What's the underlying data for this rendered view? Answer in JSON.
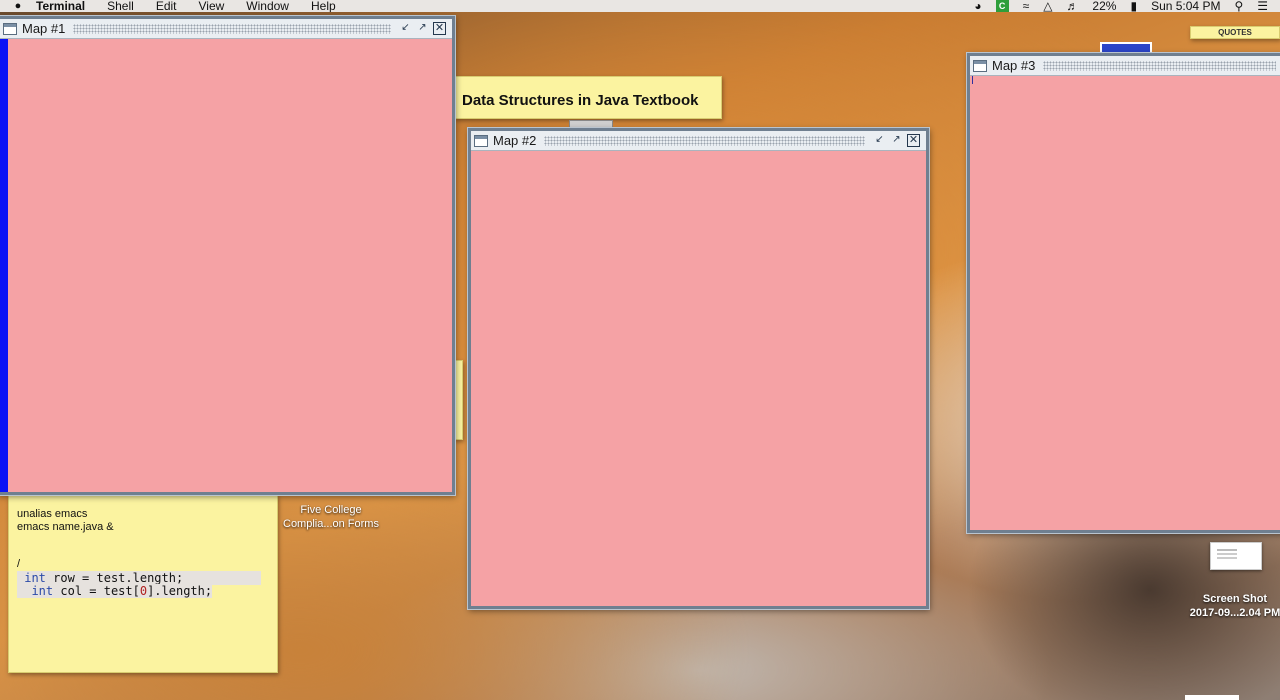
{
  "menubar": {
    "app": "Terminal",
    "items": [
      "Shell",
      "Edit",
      "View",
      "Window",
      "Help"
    ],
    "status": {
      "badge": "C",
      "battery": "22%",
      "clock": "Sun 5:04 PM"
    }
  },
  "desktop": {
    "sticky_title": "Data Structures in Java Textbook",
    "quotes_label": "QUOTES",
    "code_note": {
      "line1": "unalias emacs",
      "line2": "emacs name.java &",
      "line3": "/",
      "code1": [
        "int",
        " row = test.length;"
      ],
      "code2": [
        "int",
        " col = test[",
        "0",
        "].length;"
      ]
    },
    "icon_five_college": {
      "line1": "Five College",
      "line2": "Complia...on Forms"
    },
    "icon_screenshot": {
      "line1": "Screen Shot",
      "line2": "2017-09...2.04 PM"
    }
  },
  "windows": [
    {
      "title": "Map #1"
    },
    {
      "title": "Map #2"
    },
    {
      "title": "Map #3"
    }
  ],
  "colors": {
    "map_background": "#f5a2a5",
    "map1_strip": "#0a12f5",
    "sticky": "#fbf3a0"
  }
}
